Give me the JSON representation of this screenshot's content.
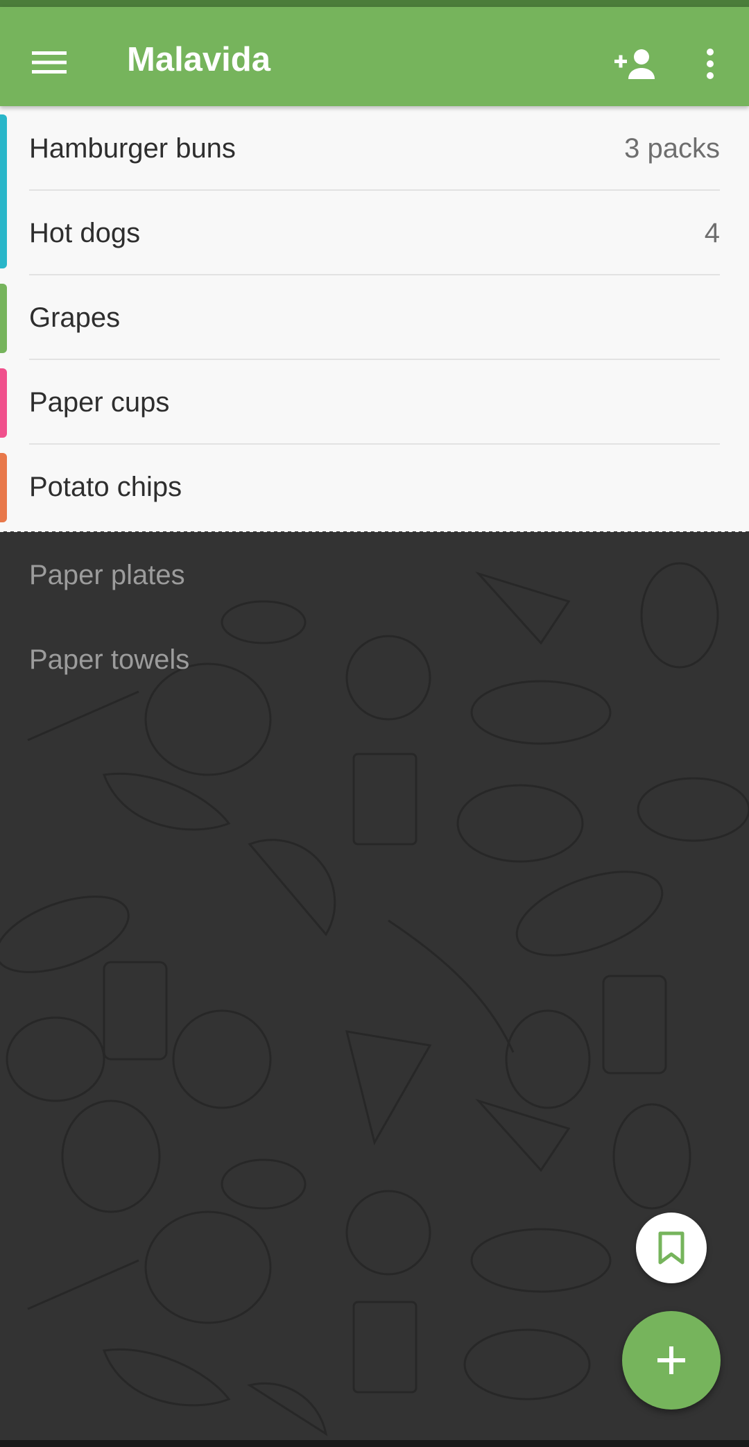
{
  "app_bar": {
    "title": "Malavida",
    "menu_icon": "menu-icon",
    "add_user_icon": "person-add-icon",
    "more_icon": "more-vert-icon",
    "color": "#76b45c"
  },
  "active_items": [
    {
      "label": "Hamburger buns",
      "quantity": "3 packs",
      "category_color": "#29b6c9"
    },
    {
      "label": "Hot dogs",
      "quantity": "4",
      "category_color": "#29b6c9"
    },
    {
      "label": "Grapes",
      "quantity": "",
      "category_color": "#76b45c"
    },
    {
      "label": "Paper cups",
      "quantity": "",
      "category_color": "#f0508c"
    },
    {
      "label": "Potato chips",
      "quantity": "",
      "category_color": "#e8784a"
    }
  ],
  "checked_items": [
    {
      "label": "Paper plates"
    },
    {
      "label": "Paper towels"
    }
  ],
  "fabs": {
    "bookmark_icon": "bookmark-icon",
    "add_icon": "plus-icon"
  }
}
